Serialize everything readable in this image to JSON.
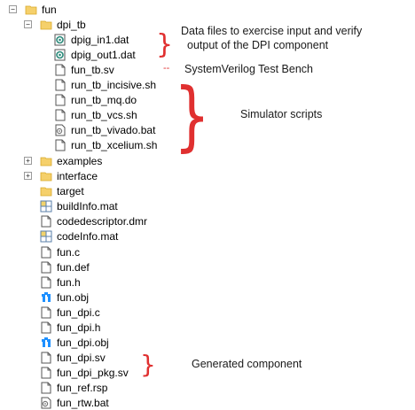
{
  "tree": {
    "root": {
      "label": "fun"
    },
    "dpi_tb": {
      "label": "dpi_tb",
      "children": [
        "dpig_in1.dat",
        "dpig_out1.dat",
        "fun_tb.sv",
        "run_tb_incisive.sh",
        "run_tb_mq.do",
        "run_tb_vcs.sh",
        "run_tb_vivado.bat",
        "run_tb_xcelium.sh"
      ]
    },
    "folders": [
      "examples",
      "interface",
      "target"
    ],
    "files": [
      "buildInfo.mat",
      "codedescriptor.dmr",
      "codeInfo.mat",
      "fun.c",
      "fun.def",
      "fun.h",
      "fun.obj",
      "fun_dpi.c",
      "fun_dpi.h",
      "fun_dpi.obj",
      "fun_dpi.sv",
      "fun_dpi_pkg.sv",
      "fun_ref.rsp",
      "fun_rtw.bat"
    ]
  },
  "annotations": {
    "data_files_line1": "Data files to exercise input and verify",
    "data_files_line2": "output of the DPI component",
    "test_bench": "SystemVerilog Test Bench",
    "test_bench_marker": "--",
    "simulator_scripts": "Simulator scripts",
    "generated_component": "Generated component"
  },
  "colors": {
    "annotation_brace": "#e03030",
    "folder": "#f2c94c",
    "obj_icon": "#1e90ff"
  }
}
